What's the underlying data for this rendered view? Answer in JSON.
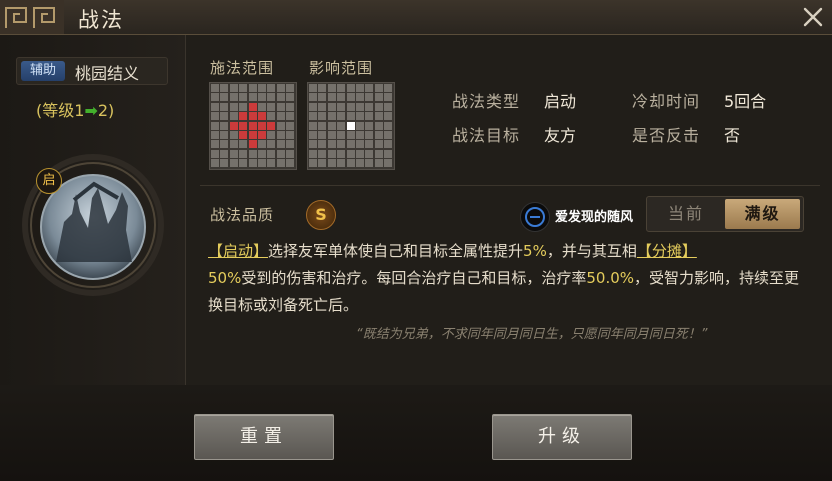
{
  "window": {
    "title": "战法"
  },
  "skill": {
    "tag": "辅助",
    "name": "桃园结义",
    "level_text": "(等级1",
    "level_arrow": "➡",
    "level_to": "2)",
    "icon_badge": "启"
  },
  "grids": {
    "cast_label": "施法范围",
    "effect_label": "影响范围"
  },
  "stats": {
    "type_label": "战法类型",
    "type_value": "启动",
    "cooldown_label": "冷却时间",
    "cooldown_value": "5回合",
    "target_label": "战法目标",
    "target_value": "友方",
    "counter_label": "是否反击",
    "counter_value": "否"
  },
  "quality": {
    "label": "战法品质",
    "value": "S"
  },
  "watermark": {
    "text": "爱发现的随风"
  },
  "toggle": {
    "current": "当前",
    "max": "满级"
  },
  "description": {
    "p1": "【启动】",
    "p2": "选择友军单体使自己和目标全属性提升",
    "p3": "5%",
    "p4": "，并与其互相",
    "p5": "【分摊】",
    "p6": "50%",
    "p7": "受到的伤害和治疗。每回合治疗自己和目标，治疗率",
    "p8": "50.0%",
    "p9": "，受智力影响，持续至更换目标或刘备死亡后。"
  },
  "quote": "“既结为兄弟，不求同年同月同日生，只愿同年同月同日死！”",
  "buttons": {
    "reset": "重置",
    "upgrade": "升级"
  },
  "colors": {
    "highlight": "#e4cc5c",
    "range_red": "#cc3b3b",
    "accent_gold": "#c9a97a"
  }
}
